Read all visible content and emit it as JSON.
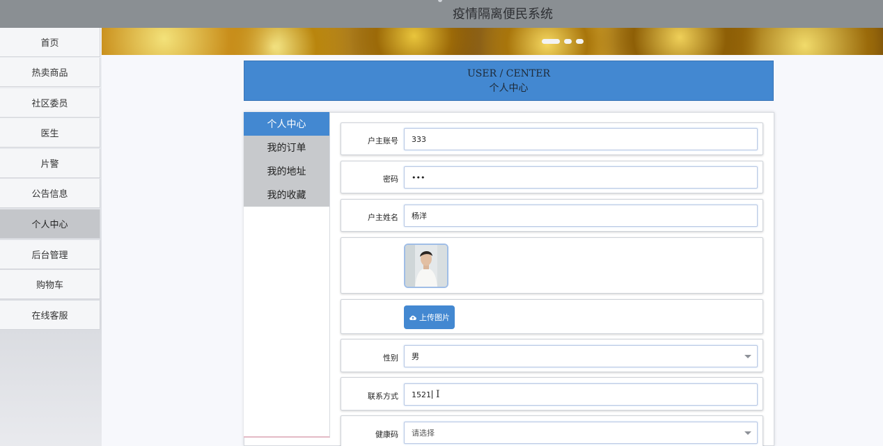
{
  "app": {
    "title": "疫情隔离便民系统"
  },
  "sidebar": {
    "items": [
      {
        "label": "首页"
      },
      {
        "label": "热卖商品"
      },
      {
        "label": "社区委员"
      },
      {
        "label": "医生"
      },
      {
        "label": "片警"
      },
      {
        "label": "公告信息"
      },
      {
        "label": "个人中心",
        "active": true
      },
      {
        "label": "后台管理"
      },
      {
        "label": "购物车"
      },
      {
        "label": "在线客服"
      }
    ]
  },
  "header": {
    "en": "USER / CENTER",
    "cn": "个人中心"
  },
  "tabs": [
    {
      "label": "个人中心",
      "active": true
    },
    {
      "label": "我的订单"
    },
    {
      "label": "我的地址"
    },
    {
      "label": "我的收藏"
    }
  ],
  "form": {
    "account_label": "户主账号",
    "account_value": "333",
    "password_label": "密码",
    "password_value": "•••",
    "name_label": "户主姓名",
    "name_value": "杨洋",
    "upload_label": "上传图片",
    "gender_label": "性别",
    "gender_value": "男",
    "phone_label": "联系方式",
    "phone_value": "1521",
    "health_label": "健康码",
    "health_placeholder": "请选择"
  },
  "colors": {
    "accent": "#4388d1",
    "topbar": "#8a8f93"
  },
  "icons": {
    "upload": "cloud-upload-icon",
    "select": "chevron-down-icon"
  }
}
